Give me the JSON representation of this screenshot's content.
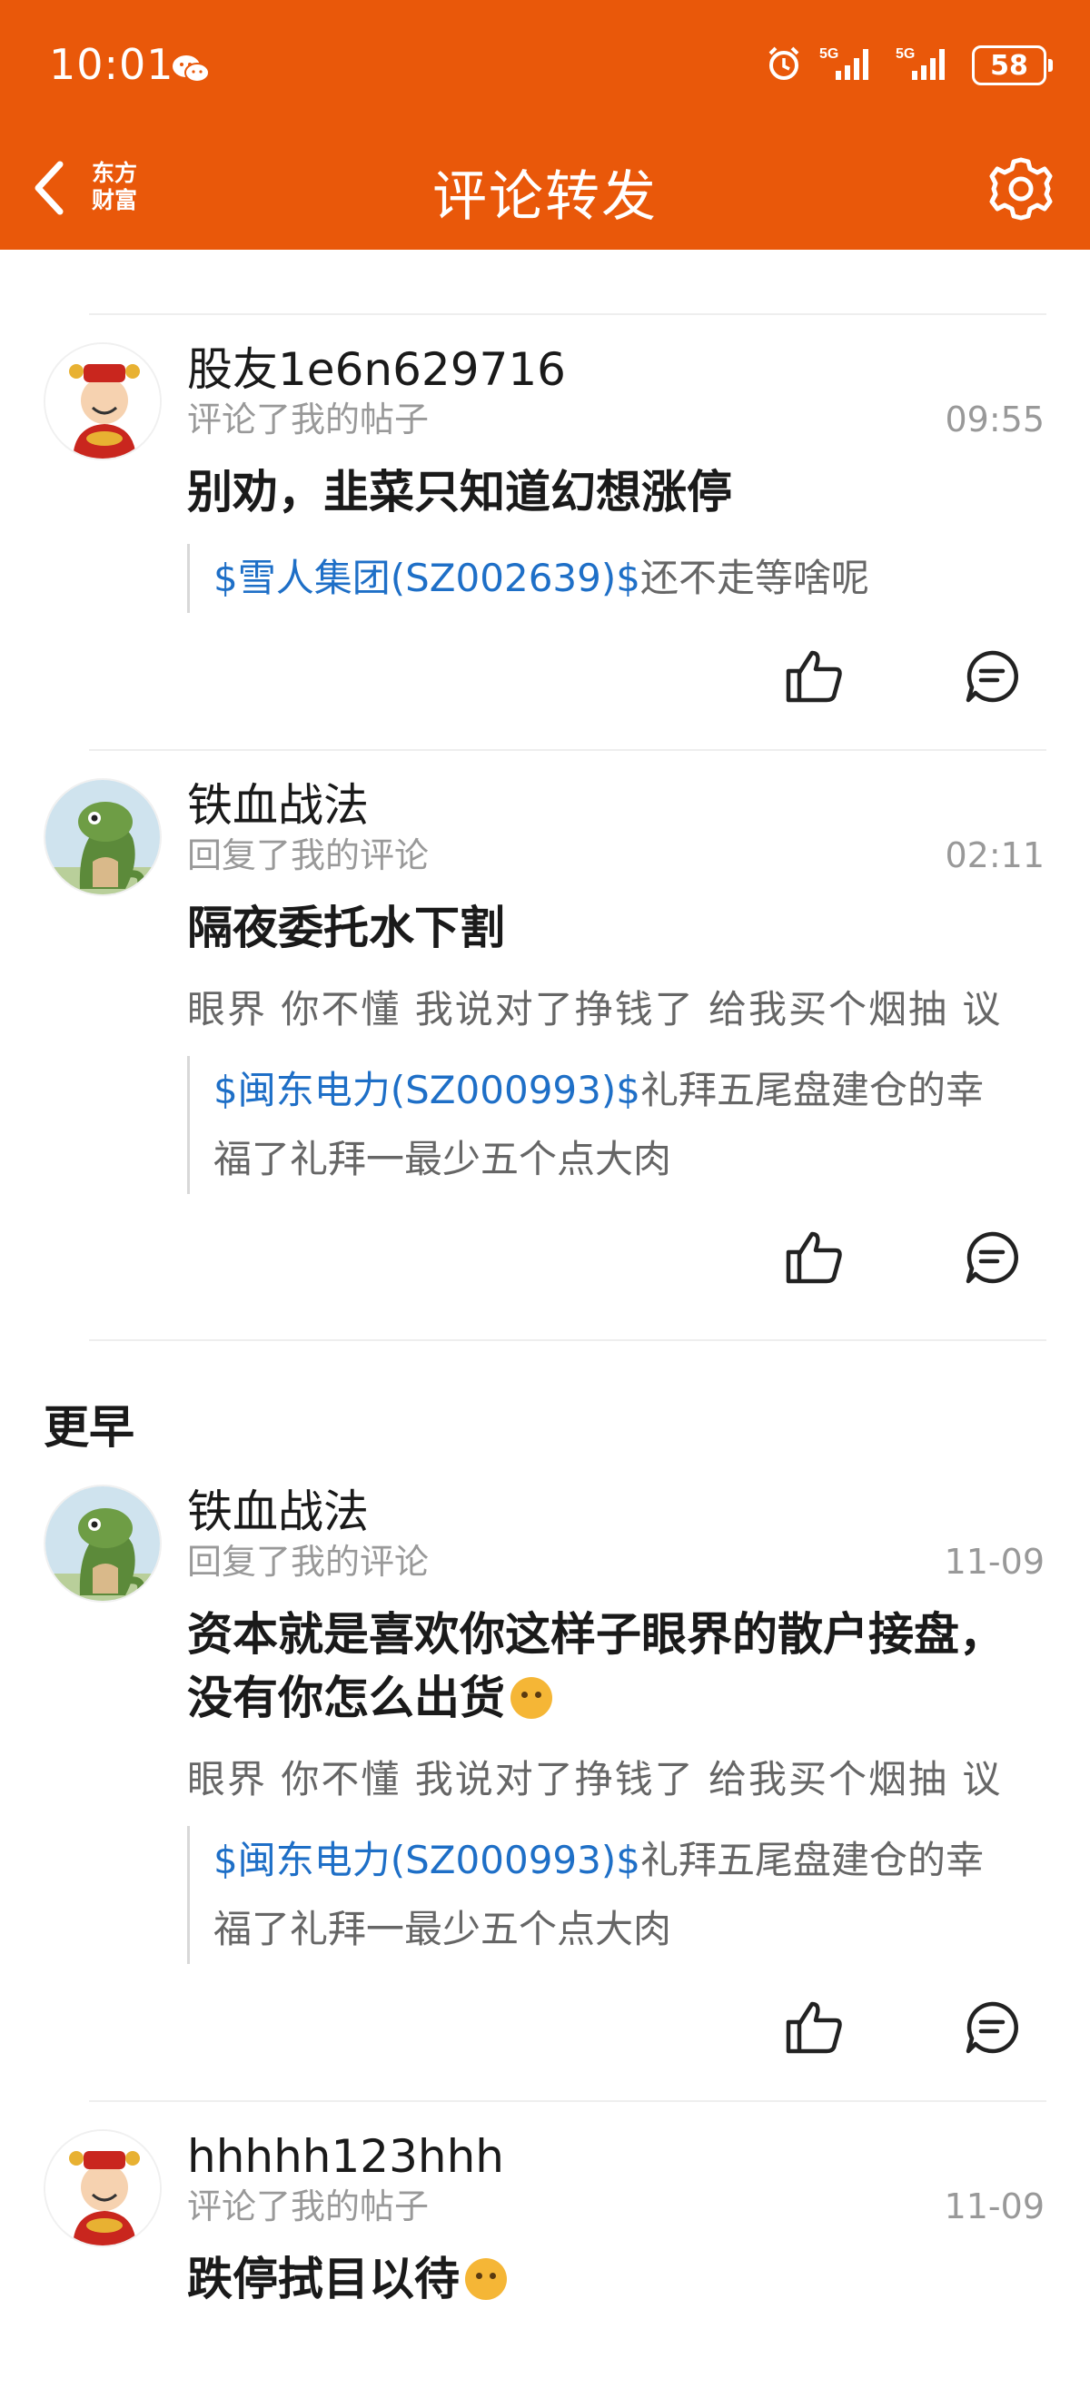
{
  "status_bar": {
    "time": "10:01",
    "battery": "58",
    "network_1": "5G",
    "network_2": "5G"
  },
  "nav": {
    "title": "评论转发",
    "logo_line1": "东方",
    "logo_line2": "财富"
  },
  "section_earlier": "更早",
  "items": [
    {
      "username": "股友1e6n629716",
      "action": "评论了我的帖子",
      "time": "09:55",
      "text": "别劝，韭菜只知道幻想涨停",
      "quote_stock": "$雪人集团(SZ002639)$",
      "quote_text": "还不走等啥呢",
      "avatar": "caishen-avatar"
    },
    {
      "username": "铁血战法",
      "action": "回复了我的评论",
      "time": "02:11",
      "text": "隔夜委托水下割",
      "reply_line": "眼界  你不懂  我说对了挣钱了  给我买个烟抽  议",
      "quote_stock": "$闽东电力(SZ000993)$",
      "quote_text_1": "礼拜五尾盘建仓的幸",
      "quote_text_2": "福了礼拜一最少五个点大肉",
      "avatar": "lizard-avatar"
    },
    {
      "username": "铁血战法",
      "action": "回复了我的评论",
      "time": "11-09",
      "text_1": "资本就是喜欢你这样子眼界的散户接盘，",
      "text_2": "没有你怎么出货",
      "reply_line": "眼界  你不懂  我说对了挣钱了  给我买个烟抽  议",
      "quote_stock": "$闽东电力(SZ000993)$",
      "quote_text_1": "礼拜五尾盘建仓的幸",
      "quote_text_2": "福了礼拜一最少五个点大肉",
      "avatar": "lizard-avatar"
    },
    {
      "username": "hhhhh123hhh",
      "action": "评论了我的帖子",
      "time": "11-09",
      "text": "跌停拭目以待",
      "avatar": "caishen-avatar"
    }
  ],
  "colors": {
    "header": "#E9580A",
    "link": "#1E6FC7",
    "meta": "#999999"
  }
}
